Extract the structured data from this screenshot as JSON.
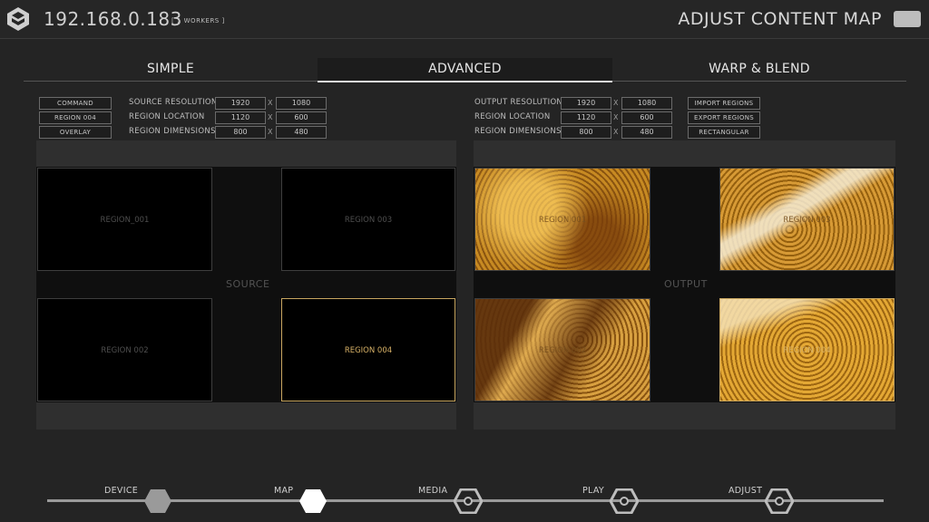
{
  "header": {
    "ip": "192.168.0.183",
    "workers": "[ 1 WORKERS ]",
    "title": "ADJUST CONTENT MAP"
  },
  "tabs": [
    "SIMPLE",
    "ADVANCED",
    "WARP & BLEND"
  ],
  "source_controls": {
    "buttons": [
      "COMMAND",
      "REGION 004",
      "OVERLAY"
    ],
    "resolution": {
      "label": "SOURCE RESOLUTION",
      "x": "1920",
      "y": "1080"
    },
    "location": {
      "label": "REGION LOCATION",
      "x": "1120",
      "y": "600"
    },
    "dimensions": {
      "label": "REGION DIMENSIONS",
      "x": "800",
      "y": "480"
    },
    "separator": "X"
  },
  "output_controls": {
    "resolution": {
      "label": "OUTPUT RESOLUTION",
      "x": "1920",
      "y": "1080"
    },
    "location": {
      "label": "REGION LOCATION",
      "x": "1120",
      "y": "600"
    },
    "dimensions": {
      "label": "REGION DIMENSIONS",
      "x": "800",
      "y": "480"
    },
    "buttons": [
      "IMPORT REGIONS",
      "EXPORT REGIONS",
      "RECTANGULAR"
    ]
  },
  "source_panel": {
    "center_label": "SOURCE",
    "regions": [
      "REGION_001",
      "REGION 003",
      "REGION 002",
      "REGION 004"
    ]
  },
  "output_panel": {
    "center_label": "OUTPUT",
    "regions": [
      "REGION 001",
      "REGION 003",
      "REGION 002",
      "REGION 004"
    ]
  },
  "nav": [
    "DEVICE",
    "MAP",
    "MEDIA",
    "PLAY",
    "ADJUST"
  ],
  "colors": {
    "accent": "#c8a660",
    "background": "#242424"
  }
}
